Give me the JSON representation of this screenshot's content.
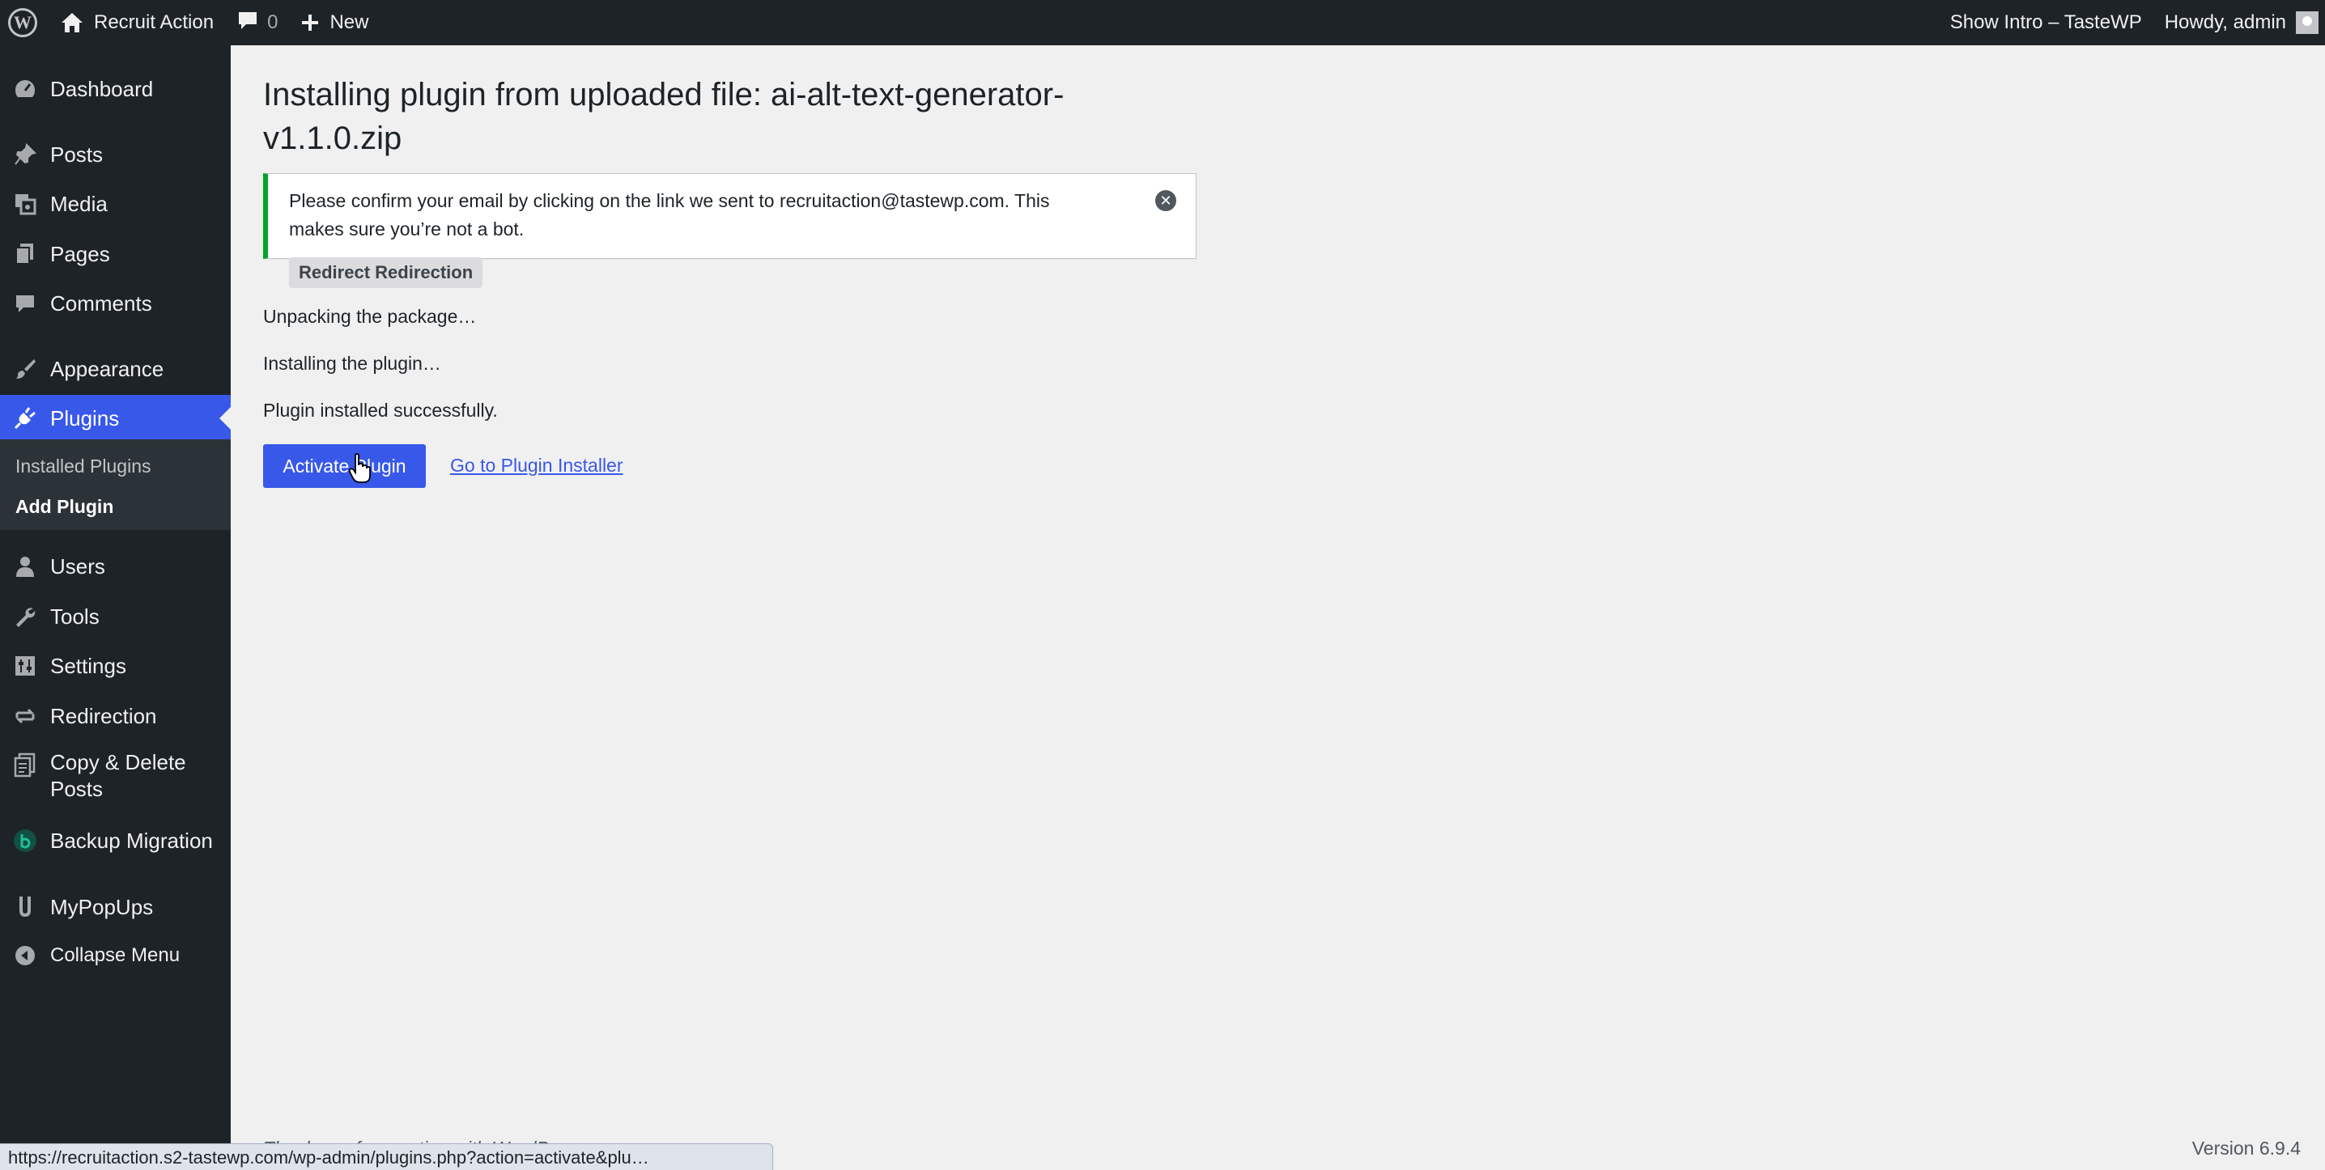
{
  "admin_bar": {
    "site_name": "Recruit Action",
    "comments_count": "0",
    "new_label": "New",
    "show_intro": "Show Intro – TasteWP",
    "howdy": "Howdy, admin"
  },
  "sidebar": {
    "items": [
      {
        "label": "Dashboard",
        "icon": "dashboard-icon"
      },
      {
        "label": "Posts",
        "icon": "pin-icon"
      },
      {
        "label": "Media",
        "icon": "media-icon"
      },
      {
        "label": "Pages",
        "icon": "pages-icon"
      },
      {
        "label": "Comments",
        "icon": "comment-icon"
      },
      {
        "label": "Appearance",
        "icon": "brush-icon"
      },
      {
        "label": "Plugins",
        "icon": "plugin-icon"
      },
      {
        "label": "Users",
        "icon": "user-icon"
      },
      {
        "label": "Tools",
        "icon": "wrench-icon"
      },
      {
        "label": "Settings",
        "icon": "settings-icon"
      },
      {
        "label": "Redirection",
        "icon": "redirect-icon"
      },
      {
        "label": "Copy & Delete Posts",
        "icon": "copy-icon"
      },
      {
        "label": "Backup Migration",
        "icon": "backup-icon"
      },
      {
        "label": "MyPopUps",
        "icon": "popup-icon"
      },
      {
        "label": "Collapse Menu",
        "icon": "collapse-icon"
      }
    ],
    "submenu": [
      {
        "label": "Installed Plugins"
      },
      {
        "label": "Add Plugin"
      }
    ]
  },
  "main": {
    "title": "Installing plugin from uploaded file: ai-alt-text-generator-v1.1.0.zip",
    "notice": "Please confirm your email by clicking on the link we sent to recruitaction@tastewp.com. This makes sure you’re not a bot.",
    "redirect_button": "Redirect Redirection",
    "status_lines": [
      "Unpacking the package…",
      "Installing the plugin…",
      "Plugin installed successfully."
    ],
    "activate_button": "Activate Plugin",
    "installer_link": "Go to Plugin Installer"
  },
  "footer": {
    "thanks": "Thank you for creating with WordPress.",
    "version": "Version 6.9.4"
  },
  "status_bar_url": "https://recruitaction.s2-tastewp.com/wp-admin/plugins.php?action=activate&plu…",
  "colors": {
    "admin_bar": "#1d2327",
    "accent": "#3858e9",
    "notice_border": "#00a32a",
    "background": "#f0f0f1"
  }
}
